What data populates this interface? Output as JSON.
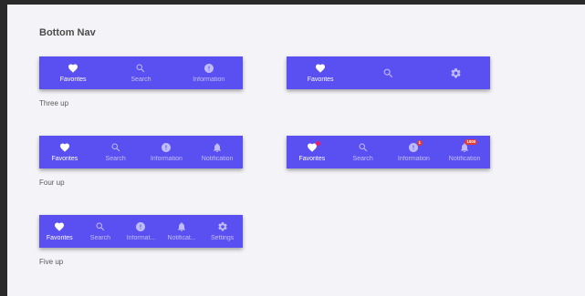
{
  "page": {
    "title": "Bottom Nav"
  },
  "captions": {
    "three_up": "Three up",
    "four_up": "Four up",
    "five_up": "Five up"
  },
  "labels": {
    "favorites": "Favorites",
    "search": "Search",
    "information": "Information",
    "notification": "Notification",
    "settings": "Settings",
    "information_truncated": "Informat...",
    "notification_truncated": "Notificat..."
  },
  "badges": {
    "information_count": "1",
    "notification_count": "1000"
  },
  "colors": {
    "nav_background": "#5a50f1",
    "badge": "#e53935",
    "dot": "#e91e63",
    "page_background": "#f4f4f8"
  },
  "icons": {
    "favorites": "heart-icon",
    "search": "search-icon",
    "information": "info-icon",
    "notification": "bell-icon",
    "settings": "gear-icon"
  }
}
